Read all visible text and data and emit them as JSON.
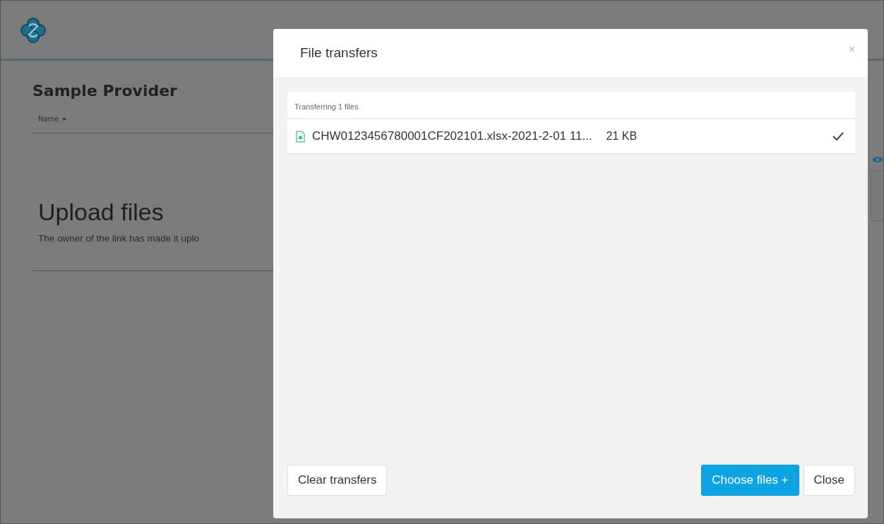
{
  "page": {
    "title": "Sample Provider",
    "sort_label": "Name",
    "heading": "Upload files",
    "description": "The owner of the link has made it uplo"
  },
  "dialog": {
    "title": "File transfers",
    "close": "×",
    "summary": "Transferring 1 files",
    "files": [
      {
        "name": "CHW0123456780001CF202101.xlsx-2021-2-01 11...",
        "size": "21 KB",
        "done": true
      }
    ],
    "buttons": [
      {
        "label": "Clear transfers",
        "kind": "default"
      },
      {
        "label": "Choose files +",
        "kind": "primary"
      },
      {
        "label": "Close",
        "kind": "default"
      }
    ]
  }
}
